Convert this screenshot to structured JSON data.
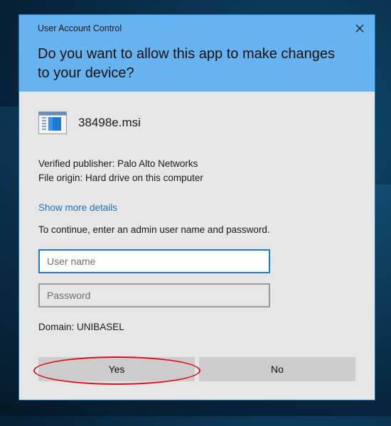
{
  "dialog": {
    "header_title": "User Account Control",
    "question": "Do you want to allow this app to make changes to your device?",
    "app_name": "38498e.msi",
    "publisher_line": "Verified publisher: Palo Alto Networks",
    "origin_line": "File origin: Hard drive on this computer",
    "details_link": "Show more details",
    "instruction": "To continue, enter an admin user name and password.",
    "username": {
      "value": "",
      "placeholder": "User name"
    },
    "password": {
      "value": "",
      "placeholder": "Password"
    },
    "domain": "Domain: UNIBASEL",
    "yes_label": "Yes",
    "no_label": "No"
  },
  "icons": {
    "close": "close-icon",
    "app": "installer-package-icon"
  },
  "colors": {
    "header": "#66b3ef",
    "body": "#e6e6e6",
    "link": "#1e6fc4",
    "focus_border": "#1a7bd3",
    "annotation": "#d8101b"
  }
}
